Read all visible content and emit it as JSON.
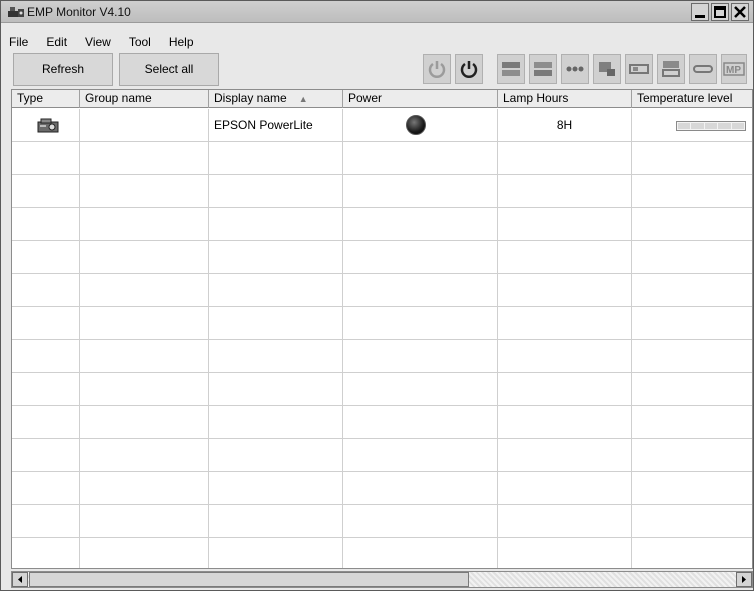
{
  "window": {
    "title": "EMP Monitor V4.10"
  },
  "menu": [
    {
      "label": "File"
    },
    {
      "label": "Edit"
    },
    {
      "label": "View"
    },
    {
      "label": "Tool"
    },
    {
      "label": "Help"
    }
  ],
  "toolbar": {
    "refresh_label": "Refresh",
    "select_all_label": "Select all",
    "icons": [
      "power-on-icon",
      "power-off-icon",
      "source-computer1-icon",
      "source-computer2-icon",
      "source-video-icon",
      "source-s-video-icon",
      "av-mute-icon",
      "freeze-icon",
      "resize-icon",
      "mp-icon"
    ]
  },
  "table": {
    "columns": [
      "Type",
      "Group name",
      "Display name",
      "Power",
      "Lamp Hours",
      "Temperature level"
    ],
    "sort_indicator": "▲",
    "rows": [
      {
        "type_icon": "projector-icon",
        "group_name": "",
        "display_name": "EPSON PowerLite",
        "power_icon": "power-status-icon",
        "lamp_hours": "8H",
        "temperature_level": 0
      }
    ],
    "empty_row_count": 13
  }
}
